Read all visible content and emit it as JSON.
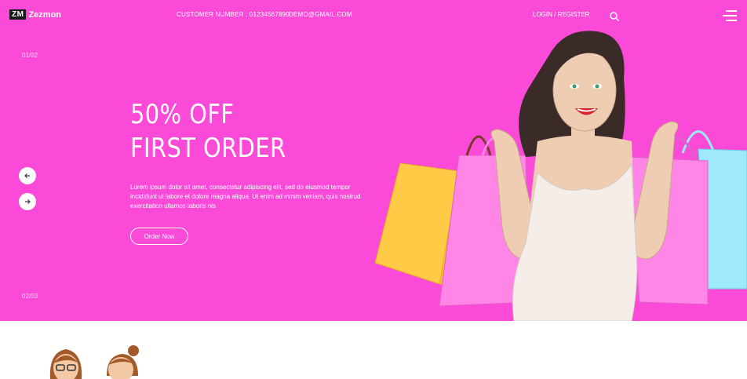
{
  "header": {
    "logo_badge": "ZM",
    "logo_text": "Zezmon",
    "customer_number": "CUSTOMER NUMBER : 01234567890",
    "email": "DEMO@GMAIL.COM",
    "login": "LOGIN / REGISTER",
    "search_icon": "search-icon",
    "menu_icon": "hamburger-menu-icon"
  },
  "hero": {
    "counter_top": "01/02",
    "counter_bottom": "02/03",
    "headline_line1": "50% OFF",
    "headline_line2": "FIRST ORDER",
    "description": "Lorem ipsum dolor sit amet, consectetur adipiscing elit, sed do eiusmod tempor incididunt ut labore et dolore magna aliqua. Ut enim ad minim veniam, quis nostrud exercitation ullamco laboris nis",
    "cta": "Order Now",
    "prev_icon": "arrow-left-icon",
    "next_icon": "arrow-right-icon",
    "background_color": "#fb4ad8"
  }
}
